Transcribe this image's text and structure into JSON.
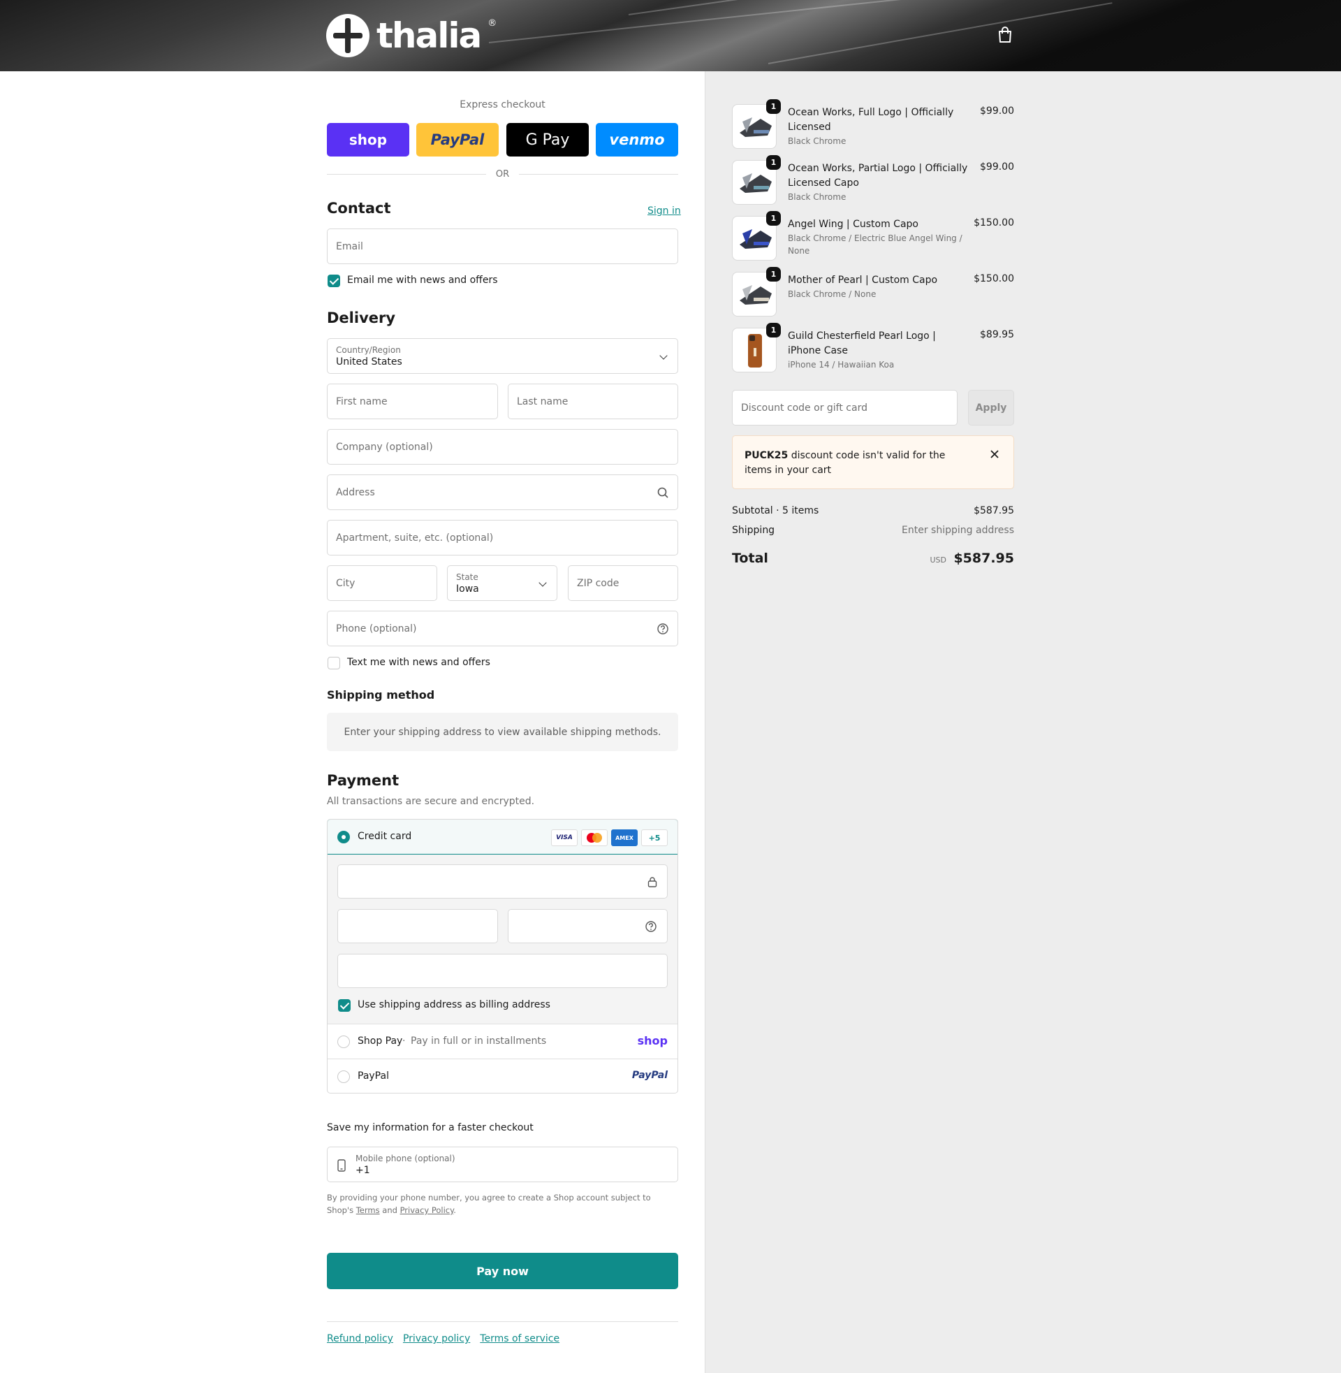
{
  "header": {
    "brand": "thalia",
    "registered": "®",
    "cart_icon": "shopping-bag-icon"
  },
  "express": {
    "title": "Express checkout",
    "buttons": [
      "shop",
      "PayPal",
      "G Pay",
      "venmo"
    ],
    "or_text": "OR"
  },
  "contact": {
    "title": "Contact",
    "sign_in": "Sign in",
    "email_placeholder": "Email",
    "news_label": "Email me with news and offers",
    "news_checked": true
  },
  "delivery": {
    "title": "Delivery",
    "country_label": "Country/Region",
    "country_value": "United States",
    "first_name": "First name",
    "last_name": "Last name",
    "company": "Company (optional)",
    "address": "Address",
    "apartment": "Apartment, suite, etc. (optional)",
    "city": "City",
    "state_label": "State",
    "state_value": "Iowa",
    "zip": "ZIP code",
    "phone": "Phone (optional)",
    "text_news_label": "Text me with news and offers",
    "text_news_checked": false
  },
  "shipping_method": {
    "title": "Shipping method",
    "info": "Enter your shipping address to view available shipping methods."
  },
  "payment": {
    "title": "Payment",
    "subtitle": "All transactions are secure and encrypted.",
    "credit_card_label": "Credit card",
    "card_badges": [
      "VISA",
      "MC",
      "AMEX",
      "+5"
    ],
    "billing_label": "Use shipping address as billing address",
    "billing_checked": true,
    "shop_pay_label": "Shop Pay",
    "shop_pay_sub": "Pay in full or in installments",
    "shop_pay_logo": "shop",
    "paypal_label": "PayPal",
    "paypal_logo": "PayPal"
  },
  "save_info": {
    "title": "Save my information for a faster checkout",
    "mobile_label": "Mobile phone (optional)",
    "mobile_value": "+1",
    "disclaimer_pre": "By providing your phone number, you agree to create a Shop account subject to Shop's",
    "terms": "Terms",
    "and": "and",
    "privacy": "Privacy Policy",
    "period": "."
  },
  "pay_now": "Pay now",
  "footer": {
    "links": [
      "Refund policy",
      "Privacy policy",
      "Terms of service"
    ]
  },
  "order": {
    "items": [
      {
        "name": "Ocean Works, Full Logo | Officially Licensed",
        "variant": "Black Chrome",
        "price": "$99.00",
        "qty": "1"
      },
      {
        "name": "Ocean Works, Partial Logo | Officially Licensed Capo",
        "variant": "Black Chrome",
        "price": "$99.00",
        "qty": "1"
      },
      {
        "name": "Angel Wing | Custom Capo",
        "variant": "Black Chrome / Electric Blue Angel Wing / None",
        "price": "$150.00",
        "qty": "1"
      },
      {
        "name": "Mother of Pearl | Custom Capo",
        "variant": "Black Chrome / None",
        "price": "$150.00",
        "qty": "1"
      },
      {
        "name": "Guild Chesterfield Pearl Logo | iPhone Case",
        "variant": "iPhone 14 / Hawaiian Koa",
        "price": "$89.95",
        "qty": "1"
      }
    ],
    "discount_placeholder": "Discount code or gift card",
    "apply": "Apply",
    "alert_code": "PUCK25",
    "alert_text": "discount code isn't valid for the items in your cart",
    "subtotal_label": "Subtotal · 5 items",
    "subtotal_value": "$587.95",
    "shipping_label": "Shipping",
    "shipping_value": "Enter shipping address",
    "total_label": "Total",
    "total_currency": "USD",
    "total_value": "$587.95"
  },
  "colors": {
    "accent": "#0f8c8a",
    "shop_purple": "#5a31f4",
    "paypal_yellow": "#ffc439",
    "venmo_blue": "#008cff"
  }
}
